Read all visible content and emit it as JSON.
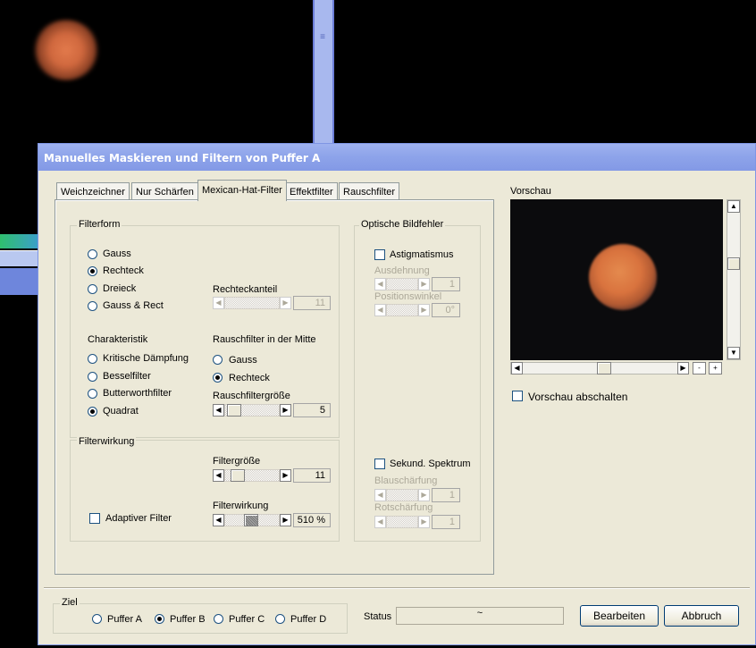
{
  "dialog": {
    "title": "Manuelles Maskieren und Filtern von Puffer A"
  },
  "tabs": [
    {
      "label": "Weichzeichner"
    },
    {
      "label": "Nur Schärfen"
    },
    {
      "label": "Mexican-Hat-Filter",
      "active": true
    },
    {
      "label": "Effektfilter"
    },
    {
      "label": "Rauschfilter"
    }
  ],
  "filterform": {
    "title": "Filterform",
    "options": [
      "Gauss",
      "Rechteck",
      "Dreieck",
      "Gauss & Rect"
    ],
    "selected": "Rechteck",
    "rechteckanteil_label": "Rechteckanteil",
    "rechteckanteil_value": "11",
    "charakteristik_label": "Charakteristik",
    "charakteristik_options": [
      "Kritische Dämpfung",
      "Besselfilter",
      "Butterworthfilter",
      "Quadrat"
    ],
    "charakteristik_selected": "Quadrat",
    "rauschmitte_label": "Rauschfilter in der Mitte",
    "rauschmitte_options": [
      "Gauss",
      "Rechteck"
    ],
    "rauschmitte_selected": "Rechteck",
    "rauschgroesse_label": "Rauschfiltergröße",
    "rauschgroesse_value": "5"
  },
  "filterwirkung": {
    "title": "Filterwirkung",
    "groesse_label": "Filtergröße",
    "groesse_value": "11",
    "wirkung_label": "Filterwirkung",
    "wirkung_value": "510 %",
    "adaptiv_label": "Adaptiver Filter"
  },
  "optik": {
    "title": "Optische Bildfehler",
    "astig_label": "Astigmatismus",
    "ausdehnung_label": "Ausdehnung",
    "ausdehnung_value": "1",
    "position_label": "Positionswinkel",
    "position_value": "0°",
    "sekund_label": "Sekund. Spektrum",
    "blau_label": "Blauschärfung",
    "blau_value": "1",
    "rot_label": "Rotschärfung",
    "rot_value": "1"
  },
  "preview": {
    "label": "Vorschau",
    "disable_label": "Vorschau abschalten",
    "zoom_minus": "-",
    "zoom_plus": "+"
  },
  "ziel": {
    "title": "Ziel",
    "options": [
      "Puffer A",
      "Puffer B",
      "Puffer C",
      "Puffer D"
    ],
    "selected": "Puffer B"
  },
  "status": {
    "label": "Status",
    "value": "~"
  },
  "buttons": {
    "bearbeiten": "Bearbeiten",
    "abbruch": "Abbruch"
  }
}
